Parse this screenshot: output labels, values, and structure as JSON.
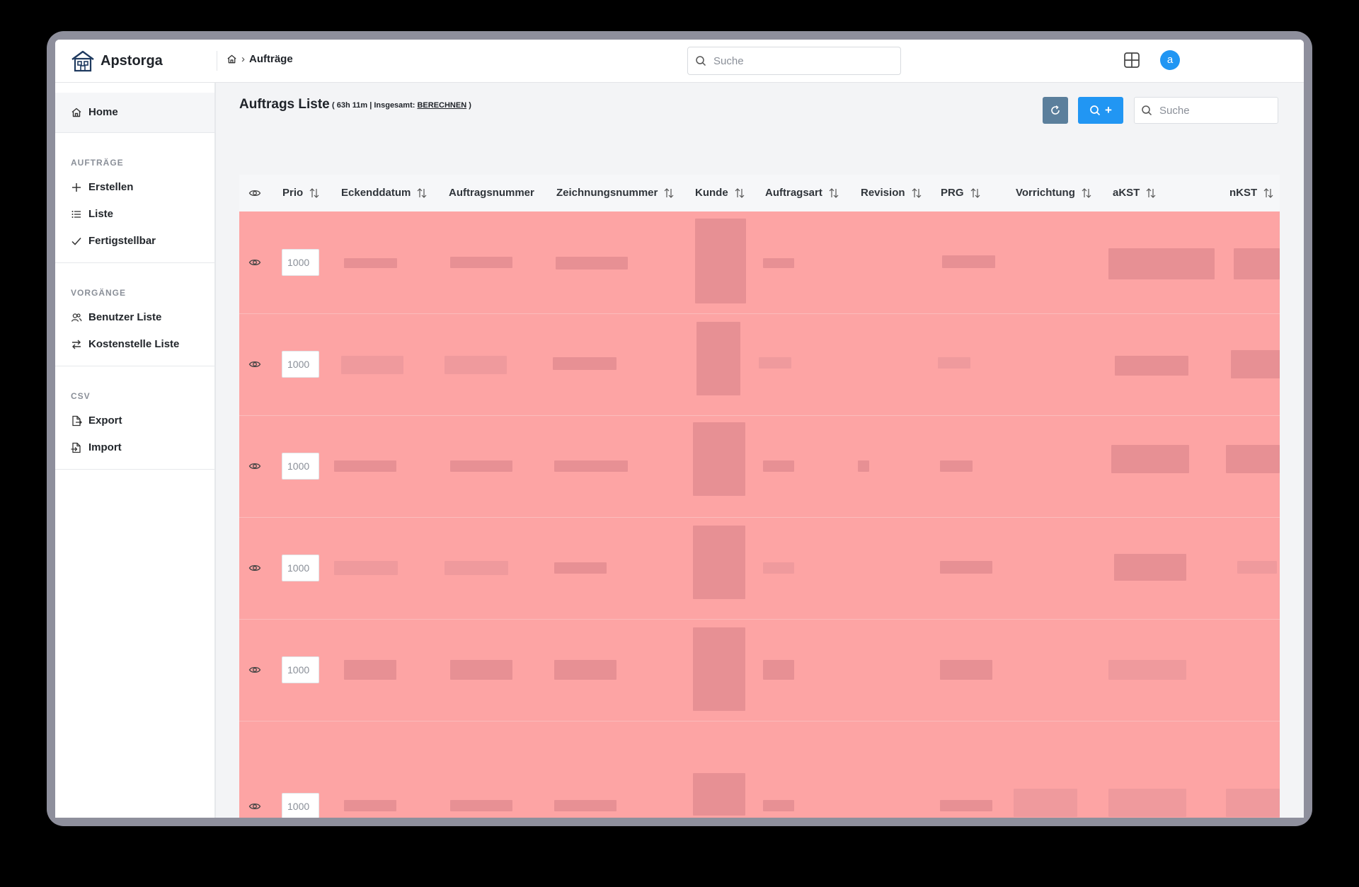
{
  "app": {
    "name": "Apstorga"
  },
  "breadcrumb": {
    "current": "Aufträge"
  },
  "top_search": {
    "placeholder": "Suche"
  },
  "user": {
    "avatar_letter": "a"
  },
  "sidebar": {
    "home": "Home",
    "sections": [
      {
        "title": "AUFTRÄGE",
        "items": [
          "Erstellen",
          "Liste",
          "Fertigstellbar"
        ]
      },
      {
        "title": "VORGÄNGE",
        "items": [
          "Benutzer Liste",
          "Kostenstelle Liste"
        ]
      },
      {
        "title": "CSV",
        "items": [
          "Export",
          "Import"
        ]
      }
    ]
  },
  "list": {
    "title": "Auftrags Liste",
    "meta_prefix": "( 63h 11m | Insgesamt: ",
    "meta_link": "BERECHNEN",
    "meta_suffix": " )",
    "search_placeholder": "Suche"
  },
  "table": {
    "columns": [
      "Prio",
      "Eckenddatum",
      "Auftragsnummer",
      "Zeichnungsnummer",
      "Kunde",
      "Auftragsart",
      "Revision",
      "PRG",
      "Vorrichtung",
      "aKST",
      "nKST"
    ],
    "rows": [
      {
        "prio": "1000"
      },
      {
        "prio": "1000"
      },
      {
        "prio": "1000"
      },
      {
        "prio": "1000"
      },
      {
        "prio": "1000"
      },
      {
        "prio": "1000"
      }
    ],
    "row_highlight_color": "#fda4a4"
  },
  "colors": {
    "primary": "#2196f3",
    "refresh_button": "#5b7f9c"
  }
}
